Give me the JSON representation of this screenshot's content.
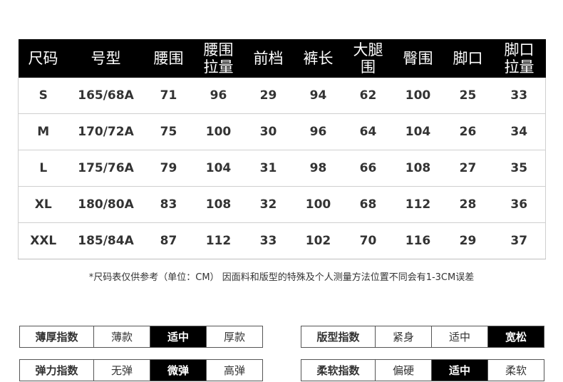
{
  "size_chart": {
    "headers": [
      [
        "尺码"
      ],
      [
        "号型"
      ],
      [
        "腰围"
      ],
      [
        "腰围",
        "拉量"
      ],
      [
        "前档"
      ],
      [
        "裤长"
      ],
      [
        "大腿",
        "围"
      ],
      [
        "臀围"
      ],
      [
        "脚口"
      ],
      [
        "脚口",
        "拉量"
      ]
    ],
    "rows": [
      [
        "S",
        "165/68A",
        "71",
        "96",
        "29",
        "94",
        "62",
        "100",
        "25",
        "33"
      ],
      [
        "M",
        "170/72A",
        "75",
        "100",
        "30",
        "96",
        "64",
        "104",
        "26",
        "34"
      ],
      [
        "L",
        "175/76A",
        "79",
        "104",
        "31",
        "98",
        "66",
        "108",
        "27",
        "35"
      ],
      [
        "XL",
        "180/80A",
        "83",
        "108",
        "32",
        "100",
        "68",
        "112",
        "28",
        "36"
      ],
      [
        "XXL",
        "185/84A",
        "87",
        "112",
        "33",
        "102",
        "70",
        "116",
        "29",
        "37"
      ]
    ]
  },
  "note": "*尺码表仅供参考（单位：CM） 因面料和版型的特殊及个人测量方法位置不同会有1-3CM误差",
  "indices": [
    {
      "label": "薄厚指数",
      "options": [
        "薄款",
        "适中",
        "厚款"
      ],
      "selected": 1
    },
    {
      "label": "版型指数",
      "options": [
        "紧身",
        "适中",
        "宽松"
      ],
      "selected": 2
    },
    {
      "label": "弹力指数",
      "options": [
        "无弹",
        "微弹",
        "高弹"
      ],
      "selected": 1
    },
    {
      "label": "柔软指数",
      "options": [
        "偏硬",
        "适中",
        "柔软"
      ],
      "selected": 1
    }
  ]
}
